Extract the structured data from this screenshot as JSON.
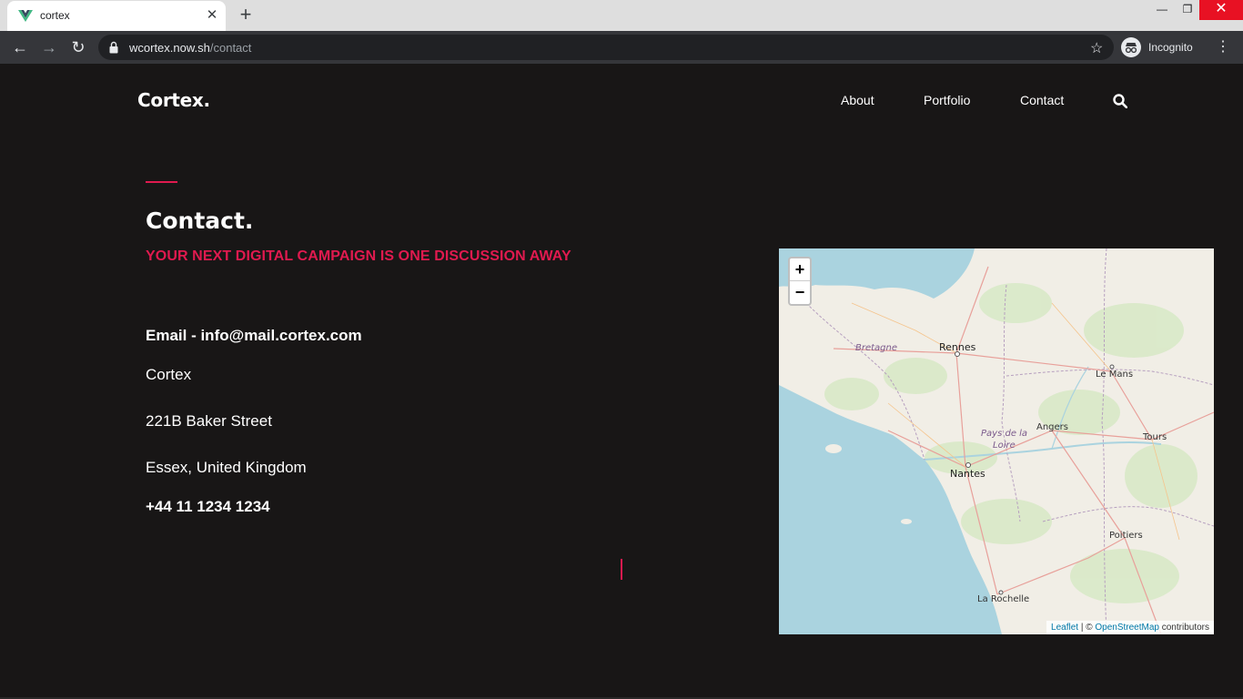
{
  "browser": {
    "tab_title": "cortex",
    "url_host": "wcortex.now.sh",
    "url_path": "/contact",
    "profile_label": "Incognito",
    "new_tab_glyph": "+",
    "tab_close_glyph": "✕"
  },
  "header": {
    "brand": "Cortex.",
    "nav": {
      "about": "About",
      "portfolio": "Portfolio",
      "contact": "Contact"
    }
  },
  "main": {
    "title": "Contact.",
    "subtitle": "YOUR NEXT DIGITAL CAMPAIGN IS ONE DISCUSSION AWAY",
    "email_line": "Email - info@mail.cortex.com",
    "company": "Cortex",
    "street": "221B Baker Street",
    "city": "Essex, United Kingdom",
    "phone": "+44 11 1234 1234"
  },
  "map": {
    "zoom_in": "+",
    "zoom_out": "−",
    "labels": {
      "rennes": "Rennes",
      "le_mans": "Le Mans",
      "angers": "Angers",
      "tours": "Tours",
      "nantes": "Nantes",
      "poitiers": "Poitiers",
      "la_rochelle": "La Rochelle",
      "bretagne": "Bretagne",
      "pays_de_la": "Pays de la",
      "loire": "Loire"
    },
    "attribution": {
      "leaflet": "Leaflet",
      "separator": " | © ",
      "osm": "OpenStreetMap",
      "contributors": " contributors"
    }
  },
  "colors": {
    "background": "#181616",
    "accent": "#e01a4f",
    "text": "#ffffff",
    "sea": "#aad3df",
    "land": "#f1eee6"
  }
}
